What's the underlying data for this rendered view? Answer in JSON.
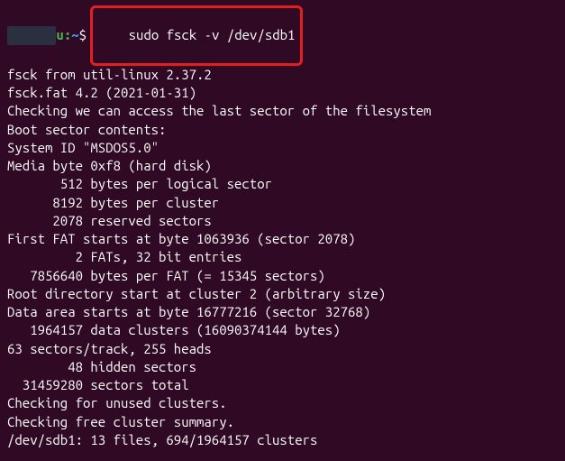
{
  "prompt": {
    "user_host_hidden": "      ",
    "user_host_visible": "u",
    "separator": ":",
    "path": "~",
    "symbol": "$ "
  },
  "command": "sudo fsck -v /dev/sdb1",
  "output_lines": [
    "fsck from util-linux 2.37.2",
    "fsck.fat 4.2 (2021-01-31)",
    "Checking we can access the last sector of the filesystem",
    "Boot sector contents:",
    "System ID \"MSDOS5.0\"",
    "Media byte 0xf8 (hard disk)",
    "       512 bytes per logical sector",
    "      8192 bytes per cluster",
    "      2078 reserved sectors",
    "First FAT starts at byte 1063936 (sector 2078)",
    "         2 FATs, 32 bit entries",
    "   7856640 bytes per FAT (= 15345 sectors)",
    "Root directory start at cluster 2 (arbitrary size)",
    "Data area starts at byte 16777216 (sector 32768)",
    "   1964157 data clusters (16090374144 bytes)",
    "63 sectors/track, 255 heads",
    "        48 hidden sectors",
    "  31459280 sectors total",
    "Checking for unused clusters.",
    "Checking free cluster summary.",
    "/dev/sdb1: 13 files, 694/1964157 clusters"
  ]
}
